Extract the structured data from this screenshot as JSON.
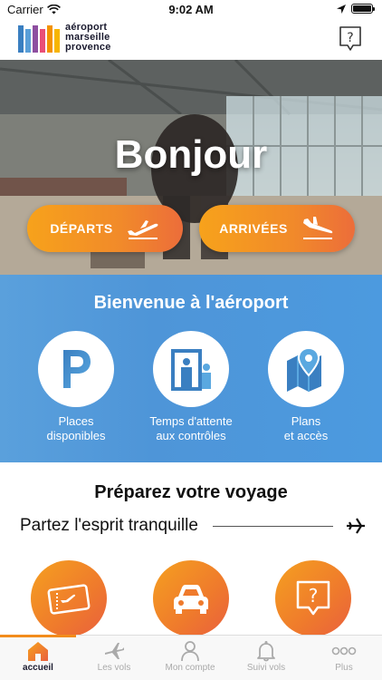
{
  "status_bar": {
    "carrier": "Carrier",
    "time": "9:02 AM"
  },
  "header": {
    "logo_lines": [
      "aéroport",
      "marseille",
      "provence"
    ],
    "logo_colors": [
      "#3a7fc1",
      "#5a9fd8",
      "#8e4fa0",
      "#e94e77",
      "#f39200",
      "#f7b500"
    ]
  },
  "hero": {
    "title": "Bonjour",
    "departures_label": "DÉPARTS",
    "arrivals_label": "ARRIVÉES"
  },
  "welcome": {
    "title": "Bienvenue à l'aéroport",
    "services": [
      {
        "line1": "Places",
        "line2": "disponibles",
        "icon": "parking-icon"
      },
      {
        "line1": "Temps d'attente",
        "line2": "aux contrôles",
        "icon": "security-check-icon"
      },
      {
        "line1": "Plans",
        "line2": "et accès",
        "icon": "map-pin-icon"
      }
    ]
  },
  "prepare": {
    "title": "Préparez votre voyage",
    "tagline": "Partez l'esprit tranquille",
    "items": [
      "ticket-icon",
      "car-icon",
      "help-bubble-icon"
    ]
  },
  "tab_bar": {
    "tabs": [
      {
        "label": "accueil",
        "icon": "home-icon",
        "active": true
      },
      {
        "label": "Les vols",
        "icon": "plane-icon",
        "active": false
      },
      {
        "label": "Mon compte",
        "icon": "user-icon",
        "active": false
      },
      {
        "label": "Suivi vols",
        "icon": "bell-icon",
        "active": false
      },
      {
        "label": "Plus",
        "icon": "more-icon",
        "active": false
      }
    ]
  },
  "colors": {
    "accent_orange": "#f28c1c",
    "welcome_blue": "#4e95d8",
    "active_tab": "#1a1a2e"
  }
}
